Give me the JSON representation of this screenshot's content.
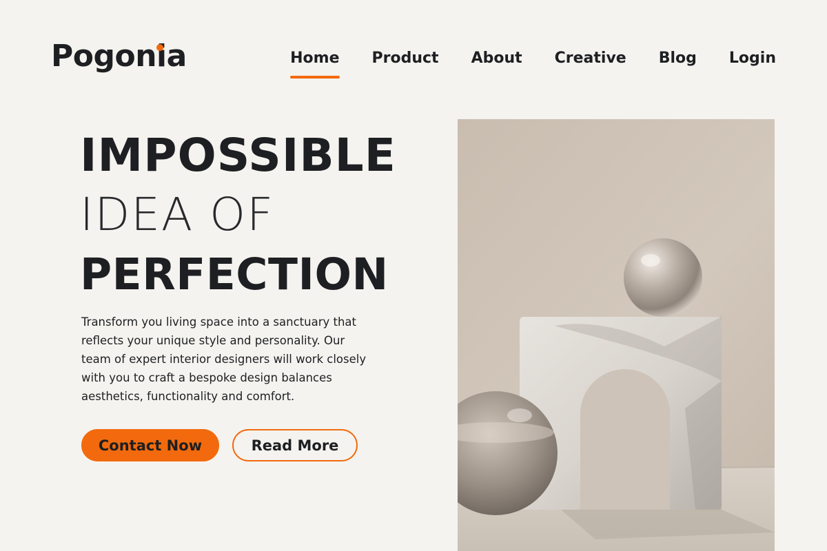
{
  "header": {
    "logo": "Pogonia",
    "nav": [
      "Home",
      "Product",
      "About",
      "Creative",
      "Blog",
      "Login"
    ],
    "active_nav": "Home"
  },
  "hero": {
    "headline_line1": "IMPOSSIBLE",
    "headline_line2": "IDEA OF",
    "headline_line3": "PERFECTION",
    "description": "Transform you living space into a sanctuary that reflects your unique style and personality. Our team of expert interior designers will work closely with you to craft a bespoke design balances aesthetics, functionality and comfort.",
    "primary_button": "Contact Now",
    "secondary_button": "Read More"
  },
  "colors": {
    "accent": "#f26a0d",
    "background": "#f5f3ef",
    "text": "#1d1f22"
  }
}
